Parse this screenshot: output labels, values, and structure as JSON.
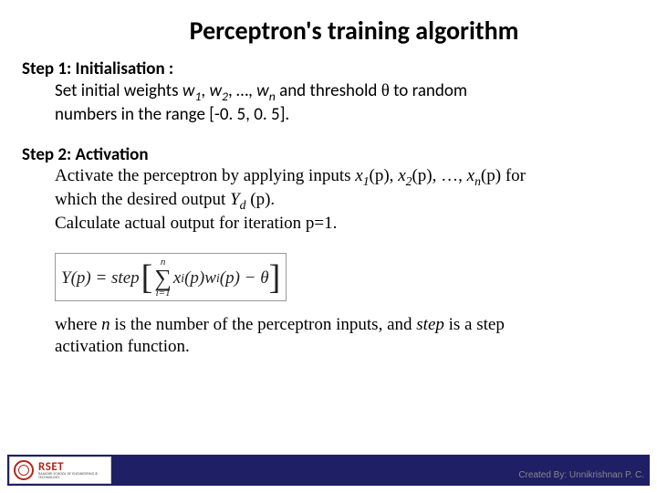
{
  "title": "Perceptron's training algorithm",
  "step1": {
    "heading": "Step 1: Initialisation :",
    "line1_a": "Set initial weights ",
    "w1": "w",
    "w1s": "1",
    "c1": ", ",
    "w2": "w",
    "w2s": "2",
    "c2": ", …, ",
    "wn": "w",
    "wns": "n",
    "line1_b": " and threshold ",
    "theta": "θ",
    "line1_c": "  to random",
    "line2": "numbers in the range [-0. 5, 0. 5]."
  },
  "step2": {
    "heading": "Step 2: Activation",
    "line1_a": "Activate the perceptron by applying inputs ",
    "x1": "x",
    "x1s": "1",
    "xp1": "(p), ",
    "x2": "x",
    "x2s": "2",
    "xp2": "(p), …, ",
    "xn": "x",
    "xns": "n",
    "xpn": "(p) ",
    "for": "for",
    "line2_a": "which the desired output ",
    "Yd": "Y",
    "Yds": "d",
    "Ydp": " (p).",
    "line3": "Calculate actual output for iteration p=1."
  },
  "formula": {
    "lhs": "Y(p) = step",
    "sum_top": "n",
    "sum_bot": "i=1",
    "inside_a": "x",
    "inside_as": "i",
    "inside_b": "(p)w",
    "inside_bs": "i",
    "inside_c": "(p) − θ"
  },
  "closing": {
    "a": "where ",
    "n": "n",
    "b": " is the number of the perceptron inputs, and ",
    "step": "step",
    "c": " is a step",
    "d": "activation function."
  },
  "logo": {
    "main": "RSET",
    "sub": "RAJAGIRI SCHOOL OF ENGINEERING & TECHNOLOGY"
  },
  "credit": "Created By: Unnikrishnan P. C."
}
